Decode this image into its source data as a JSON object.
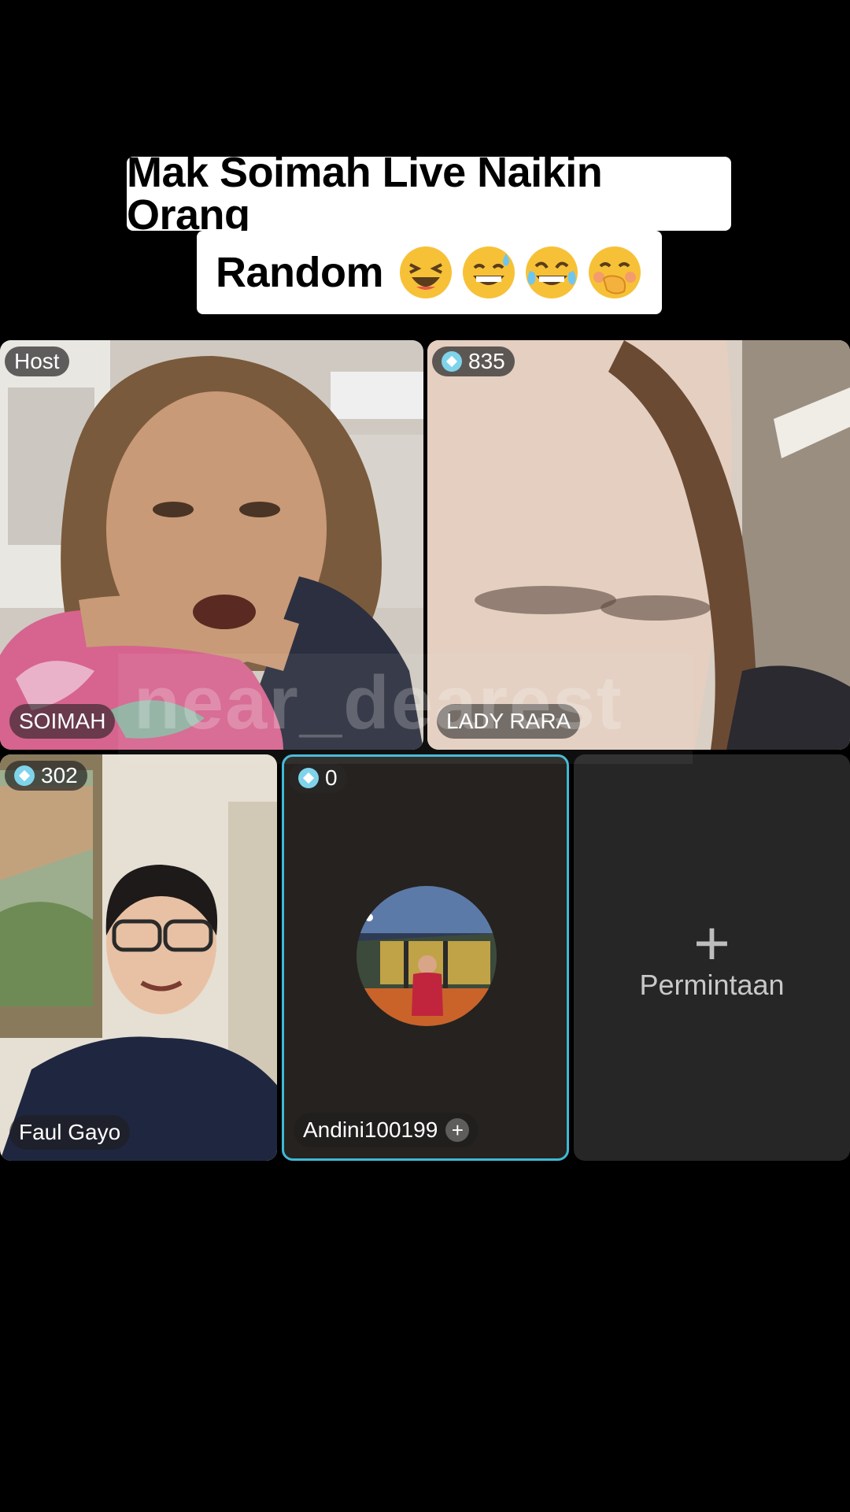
{
  "caption": {
    "line1": "Mak Soimah Live Naikin Orang",
    "line2": "Random"
  },
  "emojis": [
    "laughing-face",
    "grinning-sweat-face",
    "tears-of-joy-face",
    "face-with-hand-over-mouth"
  ],
  "watermark": "near_dearest",
  "tiles": {
    "host": {
      "badge": "Host",
      "name": "SOIMAH"
    },
    "rara": {
      "count": "835",
      "name": "LADY RARA"
    },
    "faul": {
      "count": "302",
      "name": "Faul Gayo"
    },
    "andini": {
      "count": "0",
      "name": "Andini100199"
    },
    "request": {
      "plus": "+",
      "label": "Permintaan"
    }
  },
  "colors": {
    "accent": "#3fb8d6",
    "gem": "#7fd3ea",
    "background": "#000000"
  }
}
